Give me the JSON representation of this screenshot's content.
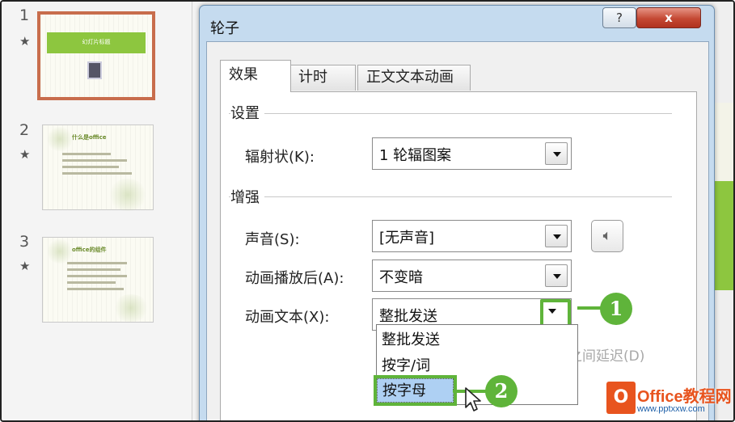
{
  "slides": [
    {
      "number": "1",
      "star": "★",
      "title_text": "幻灯片标题"
    },
    {
      "number": "2",
      "star": "★",
      "title_text": "什么是office"
    },
    {
      "number": "3",
      "star": "★",
      "title_text": "office的组件"
    }
  ],
  "dialog": {
    "title": "轮子",
    "help_label": "?",
    "close_label": "x",
    "tabs": [
      "效果",
      "计时",
      "正文文本动画"
    ],
    "settings_group": "设置",
    "spokes_label": "辐射状(K):",
    "spokes_value": "1 轮辐图案",
    "enhance_group": "增强",
    "sound_label": "声音(S):",
    "sound_value": "[无声音]",
    "after_anim_label": "动画播放后(A):",
    "after_anim_value": "不变暗",
    "anim_text_label": "动画文本(X):",
    "anim_text_value": "整批发送",
    "dropdown_options": [
      "整批发送",
      "按字/词",
      "按字母"
    ],
    "delay_label_partial": "之间延迟(D)"
  },
  "callouts": [
    "1",
    "2"
  ],
  "watermark": {
    "logo": "O",
    "text": "Office教程网",
    "sub": "www.pptxxw.com"
  },
  "colors": {
    "accent_green": "#5fb43a",
    "selection_orange": "#c86d4c",
    "dropdown_selection": "#aed0f3"
  }
}
